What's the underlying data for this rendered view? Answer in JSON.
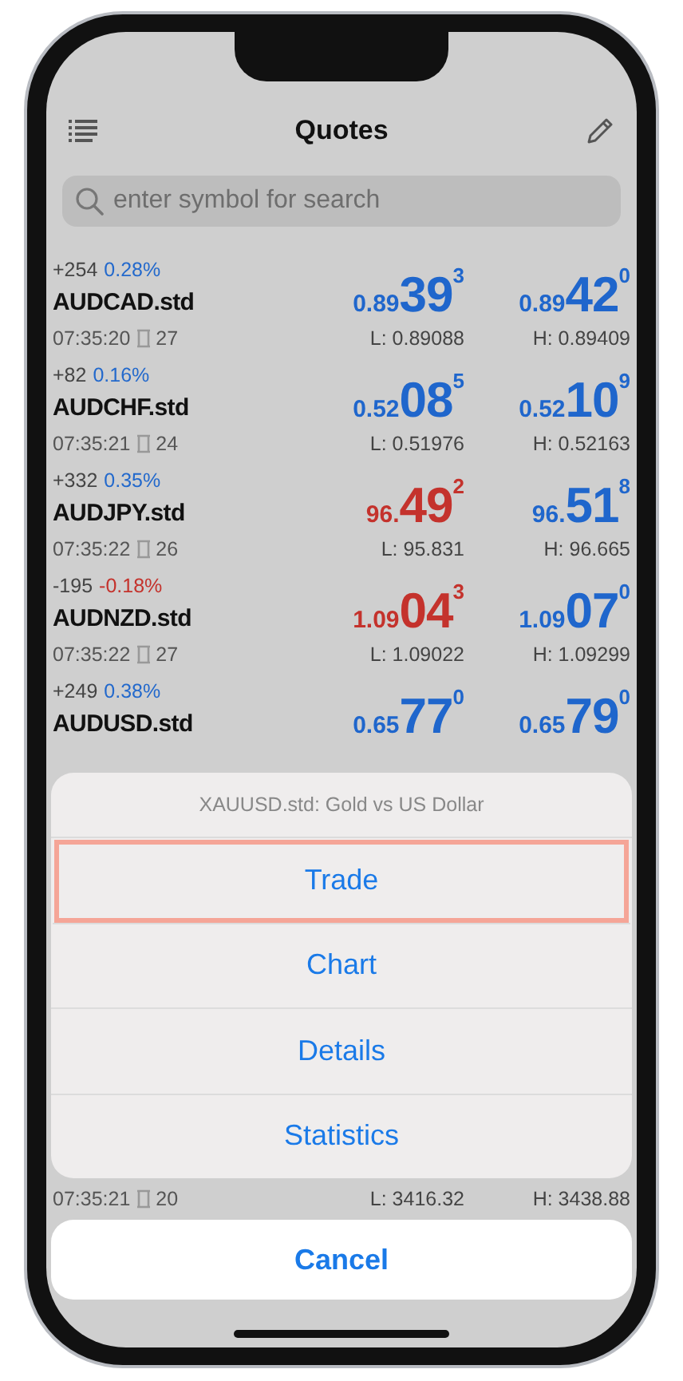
{
  "nav": {
    "title": "Quotes"
  },
  "search": {
    "placeholder": "enter symbol for search"
  },
  "quotes": [
    {
      "change_points": "+254",
      "change_percent": "0.28%",
      "change_down": false,
      "symbol": "AUDCAD.std",
      "time": "07:35:20",
      "spread": "27",
      "bid": {
        "prefix": "0.89",
        "big": "39",
        "sup": "3",
        "down": false
      },
      "ask": {
        "prefix": "0.89",
        "big": "42",
        "sup": "0",
        "down": false
      },
      "low": "L: 0.89088",
      "high": "H: 0.89409"
    },
    {
      "change_points": "+82",
      "change_percent": "0.16%",
      "change_down": false,
      "symbol": "AUDCHF.std",
      "time": "07:35:21",
      "spread": "24",
      "bid": {
        "prefix": "0.52",
        "big": "08",
        "sup": "5",
        "down": false
      },
      "ask": {
        "prefix": "0.52",
        "big": "10",
        "sup": "9",
        "down": false
      },
      "low": "L: 0.51976",
      "high": "H: 0.52163"
    },
    {
      "change_points": "+332",
      "change_percent": "0.35%",
      "change_down": false,
      "symbol": "AUDJPY.std",
      "time": "07:35:22",
      "spread": "26",
      "bid": {
        "prefix": "96.",
        "big": "49",
        "sup": "2",
        "down": true
      },
      "ask": {
        "prefix": "96.",
        "big": "51",
        "sup": "8",
        "down": false
      },
      "low": "L: 95.831",
      "high": "H: 96.665"
    },
    {
      "change_points": "-195",
      "change_percent": "-0.18%",
      "change_down": true,
      "symbol": "AUDNZD.std",
      "time": "07:35:22",
      "spread": "27",
      "bid": {
        "prefix": "1.09",
        "big": "04",
        "sup": "3",
        "down": true
      },
      "ask": {
        "prefix": "1.09",
        "big": "07",
        "sup": "0",
        "down": false
      },
      "low": "L: 1.09022",
      "high": "H: 1.09299"
    },
    {
      "change_points": "+249",
      "change_percent": "0.38%",
      "change_down": false,
      "symbol": "AUDUSD.std",
      "bid": {
        "prefix": "0.65",
        "big": "77",
        "sup": "0",
        "down": false
      },
      "ask": {
        "prefix": "0.65",
        "big": "79",
        "sup": "0",
        "down": false
      }
    }
  ],
  "partial_quote": {
    "time": "07:35:21",
    "spread": "20",
    "low": "L: 3416.32",
    "high": "H: 3438.88"
  },
  "action_sheet": {
    "title": "XAUUSD.std: Gold vs US Dollar",
    "actions": [
      {
        "label": "Trade",
        "highlighted": true
      },
      {
        "label": "Chart",
        "highlighted": false
      },
      {
        "label": "Details",
        "highlighted": false
      },
      {
        "label": "Statistics",
        "highlighted": false
      }
    ],
    "cancel": "Cancel"
  }
}
